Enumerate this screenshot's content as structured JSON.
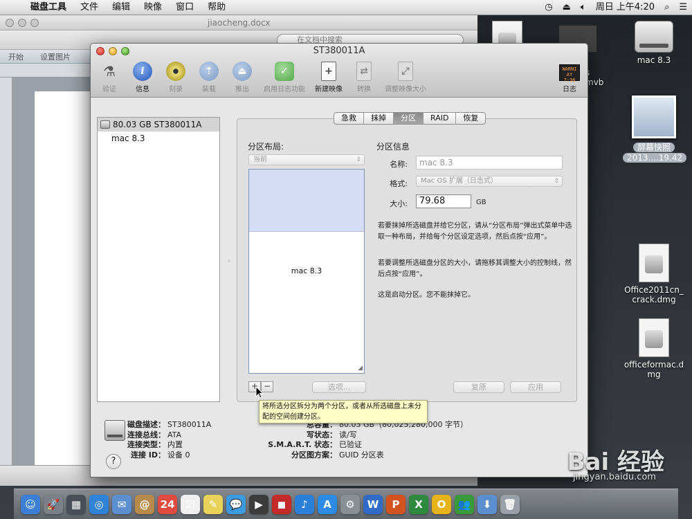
{
  "menubar": {
    "apple_glyph": "",
    "app_name": "磁盘工具",
    "items": [
      "文件",
      "编辑",
      "映像",
      "窗口",
      "帮助"
    ],
    "clock": "周日 上午4:20"
  },
  "word": {
    "title": "jiaocheng.docx",
    "search_placeholder": "在文档中搜索",
    "ribbon_tabs": [
      "开始",
      "设置图片"
    ]
  },
  "desktop": {
    "icons": [
      {
        "label": "mac 8.3"
      },
      {
        "label": "屏幕快照",
        "label2": "2013....19.42"
      },
      {
        "label": "Office2011cn_",
        "label2": "crack.dmg"
      },
      {
        "label": "officeformac.d",
        "label2": "mg"
      }
    ],
    "partial_labels": [
      "s",
      "mvb"
    ]
  },
  "disk_utility": {
    "title": "ST380011A",
    "toolbar": [
      {
        "label": "验证",
        "icon": "microscope-icon",
        "enabled": false
      },
      {
        "label": "信息",
        "icon": "info-icon",
        "enabled": true
      },
      {
        "label": "刻录",
        "icon": "burn-icon",
        "enabled": false
      },
      {
        "label": "装载",
        "icon": "mount-icon",
        "enabled": false
      },
      {
        "label": "推出",
        "icon": "eject-icon",
        "enabled": false
      },
      {
        "label": "启用日志功能",
        "icon": "journal-icon",
        "enabled": false
      },
      {
        "label": "新建映像",
        "icon": "new-image-icon",
        "enabled": true
      },
      {
        "label": "转换",
        "icon": "convert-icon",
        "enabled": false
      },
      {
        "label": "调整映像大小",
        "icon": "resize-image-icon",
        "enabled": false
      }
    ],
    "log_button": {
      "label": "日志",
      "screen_text": "WARNI\nAY 7:36"
    },
    "sidebar": {
      "disk": "80.03 GB ST380011A",
      "volume": "mac 8.3"
    },
    "tabs": [
      "急救",
      "抹掉",
      "分区",
      "RAID",
      "恢复"
    ],
    "active_tab": "分区",
    "layout": {
      "label": "分区布局:",
      "select_value": "当前",
      "partition_name": "mac 8.3"
    },
    "info": {
      "title": "分区信息",
      "name_label": "名称:",
      "name_value": "mac 8.3",
      "format_label": "格式:",
      "format_value": "Mac OS 扩展（日志式）",
      "size_label": "大小:",
      "size_value": "79.68",
      "size_unit": "GB",
      "para1": "若要抹掉所选磁盘并给它分区，请从“分区布局”弹出式菜单中选取一种布局，并给每个分区设定选项，然后点按“应用”。",
      "para2": "若要调整所选磁盘分区的大小，请拖移其调整大小的控制线，然后点按“应用”。",
      "para3": "这是启动分区。您不能抹掉它。"
    },
    "buttons": {
      "add": "+",
      "remove": "−",
      "options": "选项...",
      "revert": "复原",
      "apply": "应用"
    },
    "tooltip": "将所选分区拆分为两个分区，或者从所选磁盘上未分配的空间创建分区。",
    "footer": {
      "left": [
        {
          "k": "磁盘描述：",
          "v": "ST380011A"
        },
        {
          "k": "连接总线：",
          "v": "ATA"
        },
        {
          "k": "连接类型：",
          "v": "内置"
        },
        {
          "k": "连接 ID：",
          "v": "设备 0"
        }
      ],
      "right": [
        {
          "k": "总容量：",
          "v": "80.03 GB（80,025,280,000 字节）"
        },
        {
          "k": "写状态：",
          "v": "读/写"
        },
        {
          "k": "S.M.A.R.T. 状态：",
          "v": "已验证"
        },
        {
          "k": "分区图方案：",
          "v": "GUID 分区表"
        }
      ],
      "help": "?"
    }
  },
  "dock": {
    "items": [
      {
        "name": "finder",
        "glyph": "☺",
        "color": "#3d7fd4"
      },
      {
        "name": "launchpad",
        "glyph": "🚀",
        "color": "#7a7f88"
      },
      {
        "name": "mission-control",
        "glyph": "▦",
        "color": "#4a4f57"
      },
      {
        "name": "safari",
        "glyph": "◎",
        "color": "#2f84d9"
      },
      {
        "name": "mail",
        "glyph": "✉",
        "color": "#5c8fd0"
      },
      {
        "name": "contacts",
        "glyph": "@",
        "color": "#b88a4b"
      },
      {
        "name": "calendar",
        "glyph": "24",
        "color": "#e04a3f"
      },
      {
        "name": "reminders",
        "glyph": "☑",
        "color": "#f0f0f0"
      },
      {
        "name": "notes",
        "glyph": "✎",
        "color": "#e8d25a"
      },
      {
        "name": "messages",
        "glyph": "💬",
        "color": "#3c9be0"
      },
      {
        "name": "facetime",
        "glyph": "▶",
        "color": "#3b3b3b"
      },
      {
        "name": "photo-booth",
        "glyph": "◼",
        "color": "#c42a2a"
      },
      {
        "name": "itunes",
        "glyph": "♪",
        "color": "#2a7fd8"
      },
      {
        "name": "app-store",
        "glyph": "A",
        "color": "#2b8be6"
      },
      {
        "name": "system-preferences",
        "glyph": "⚙",
        "color": "#8a8f96"
      },
      {
        "name": "word",
        "glyph": "W",
        "color": "#2f6bc7"
      },
      {
        "name": "powerpoint",
        "glyph": "P",
        "color": "#d2531f"
      },
      {
        "name": "excel",
        "glyph": "X",
        "color": "#2d8a3e"
      },
      {
        "name": "outlook",
        "glyph": "O",
        "color": "#e6b418"
      },
      {
        "name": "messenger",
        "glyph": "👥",
        "color": "#3a9a3a"
      },
      {
        "name": "downloads",
        "glyph": "⬇",
        "color": "#5b8fd0"
      },
      {
        "name": "trash",
        "glyph": "🗑",
        "color": "#9aa0a7"
      }
    ]
  },
  "watermark": {
    "text": "Bai 经验",
    "url": "jingyan.baidu.com"
  }
}
